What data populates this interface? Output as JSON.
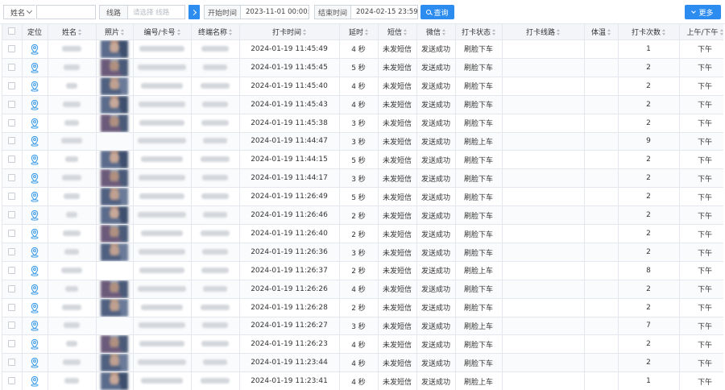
{
  "toolbar": {
    "name_select": "姓名",
    "name_input": "",
    "route_label": "线路",
    "route_placeholder": "请选择 线路",
    "start_label": "开始时间",
    "start_value": "2023-11-01 00:00:00",
    "end_label": "结束时间",
    "end_value": "2024-02-15 23:59:59",
    "query_label": "查询",
    "more_label": "更多"
  },
  "columns": [
    "定位",
    "姓名",
    "照片",
    "编号/卡号",
    "终端名称",
    "打卡时间",
    "延时",
    "短信",
    "微信",
    "打卡状态",
    "打卡线路",
    "体温",
    "打卡次数",
    "上午/下午"
  ],
  "colors": {
    "accent": "#2d8cf0",
    "header_bg": "#f3f5f8",
    "border": "#e4e8ee"
  },
  "rows": [
    {
      "time": "2024-01-19 11:45:49",
      "delay": "4 秒",
      "sms": "未发短信",
      "wechat": "发送成功",
      "status": "刷脸下车",
      "route": "",
      "temp": "",
      "count": "1",
      "ampm": "下午",
      "photo": true
    },
    {
      "time": "2024-01-19 11:45:45",
      "delay": "5 秒",
      "sms": "未发短信",
      "wechat": "发送成功",
      "status": "刷脸下车",
      "route": "",
      "temp": "",
      "count": "2",
      "ampm": "下午",
      "photo": true
    },
    {
      "time": "2024-01-19 11:45:40",
      "delay": "4 秒",
      "sms": "未发短信",
      "wechat": "发送成功",
      "status": "刷脸下车",
      "route": "",
      "temp": "",
      "count": "2",
      "ampm": "下午",
      "photo": true
    },
    {
      "time": "2024-01-19 11:45:43",
      "delay": "4 秒",
      "sms": "未发短信",
      "wechat": "发送成功",
      "status": "刷脸下车",
      "route": "",
      "temp": "",
      "count": "2",
      "ampm": "下午",
      "photo": true
    },
    {
      "time": "2024-01-19 11:45:38",
      "delay": "3 秒",
      "sms": "未发短信",
      "wechat": "发送成功",
      "status": "刷脸下车",
      "route": "",
      "temp": "",
      "count": "2",
      "ampm": "下午",
      "photo": true
    },
    {
      "time": "2024-01-19 11:44:47",
      "delay": "3 秒",
      "sms": "未发短信",
      "wechat": "发送成功",
      "status": "刷脸上车",
      "route": "",
      "temp": "",
      "count": "9",
      "ampm": "下午",
      "photo": false
    },
    {
      "time": "2024-01-19 11:44:15",
      "delay": "5 秒",
      "sms": "未发短信",
      "wechat": "发送成功",
      "status": "刷脸下车",
      "route": "",
      "temp": "",
      "count": "2",
      "ampm": "下午",
      "photo": true
    },
    {
      "time": "2024-01-19 11:44:17",
      "delay": "3 秒",
      "sms": "未发短信",
      "wechat": "发送成功",
      "status": "刷脸下车",
      "route": "",
      "temp": "",
      "count": "2",
      "ampm": "下午",
      "photo": true
    },
    {
      "time": "2024-01-19 11:26:49",
      "delay": "5 秒",
      "sms": "未发短信",
      "wechat": "发送成功",
      "status": "刷脸下车",
      "route": "",
      "temp": "",
      "count": "2",
      "ampm": "下午",
      "photo": true
    },
    {
      "time": "2024-01-19 11:26:46",
      "delay": "2 秒",
      "sms": "未发短信",
      "wechat": "发送成功",
      "status": "刷脸下车",
      "route": "",
      "temp": "",
      "count": "2",
      "ampm": "下午",
      "photo": true
    },
    {
      "time": "2024-01-19 11:26:40",
      "delay": "2 秒",
      "sms": "未发短信",
      "wechat": "发送成功",
      "status": "刷脸下车",
      "route": "",
      "temp": "",
      "count": "2",
      "ampm": "下午",
      "photo": true
    },
    {
      "time": "2024-01-19 11:26:36",
      "delay": "3 秒",
      "sms": "未发短信",
      "wechat": "发送成功",
      "status": "刷脸下车",
      "route": "",
      "temp": "",
      "count": "2",
      "ampm": "下午",
      "photo": true
    },
    {
      "time": "2024-01-19 11:26:37",
      "delay": "2 秒",
      "sms": "未发短信",
      "wechat": "发送成功",
      "status": "刷脸上车",
      "route": "",
      "temp": "",
      "count": "8",
      "ampm": "下午",
      "photo": false
    },
    {
      "time": "2024-01-19 11:26:26",
      "delay": "4 秒",
      "sms": "未发短信",
      "wechat": "发送成功",
      "status": "刷脸下车",
      "route": "",
      "temp": "",
      "count": "2",
      "ampm": "下午",
      "photo": true
    },
    {
      "time": "2024-01-19 11:26:28",
      "delay": "2 秒",
      "sms": "未发短信",
      "wechat": "发送成功",
      "status": "刷脸下车",
      "route": "",
      "temp": "",
      "count": "2",
      "ampm": "下午",
      "photo": true
    },
    {
      "time": "2024-01-19 11:26:27",
      "delay": "3 秒",
      "sms": "未发短信",
      "wechat": "发送成功",
      "status": "刷脸上车",
      "route": "",
      "temp": "",
      "count": "7",
      "ampm": "下午",
      "photo": false
    },
    {
      "time": "2024-01-19 11:26:23",
      "delay": "4 秒",
      "sms": "未发短信",
      "wechat": "发送成功",
      "status": "刷脸下车",
      "route": "",
      "temp": "",
      "count": "2",
      "ampm": "下午",
      "photo": true
    },
    {
      "time": "2024-01-19 11:23:44",
      "delay": "4 秒",
      "sms": "未发短信",
      "wechat": "发送成功",
      "status": "刷脸下车",
      "route": "",
      "temp": "",
      "count": "2",
      "ampm": "下午",
      "photo": true
    },
    {
      "time": "2024-01-19 11:23:41",
      "delay": "4 秒",
      "sms": "未发短信",
      "wechat": "发送成功",
      "status": "刷脸上车",
      "route": "",
      "temp": "",
      "count": "1",
      "ampm": "下午",
      "photo": true
    }
  ]
}
